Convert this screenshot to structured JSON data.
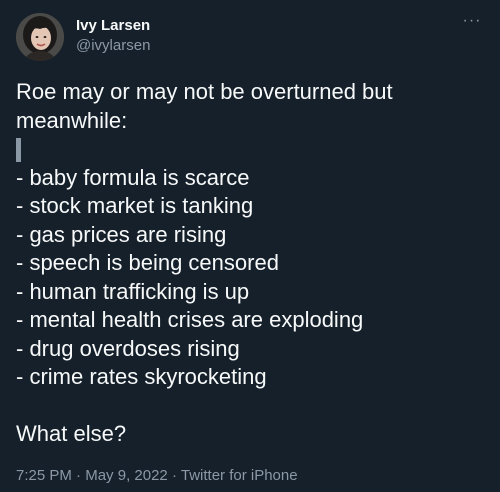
{
  "author": {
    "display_name": "Ivy Larsen",
    "handle": "@ivylarsen",
    "avatar_icon": "profile-photo"
  },
  "menu": {
    "more_icon": "more-horizontal-icon",
    "more_glyph": "···"
  },
  "tweet": {
    "intro_line_1": "Roe may or may not be overturned but",
    "intro_line_2": "meanwhile:",
    "items": [
      "- baby formula is scarce",
      "- stock market is tanking",
      "- gas prices are rising",
      "- speech is being censored",
      "- human trafficking is up",
      "- mental health crises are exploding",
      "- drug overdoses rising",
      "- crime rates skyrocketing"
    ],
    "closing": "What else?"
  },
  "meta": {
    "time": "7:25 PM",
    "separator": "·",
    "date": "May 9, 2022",
    "source": "Twitter for iPhone"
  },
  "colors": {
    "background": "#15202b",
    "text": "#f7f9f9",
    "secondary_text": "#8b98a5"
  }
}
